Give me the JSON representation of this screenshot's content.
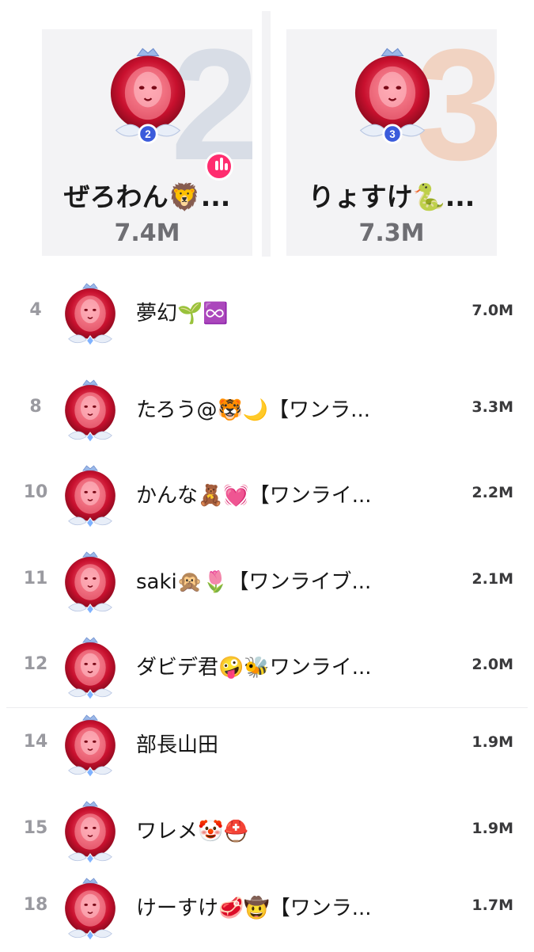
{
  "podium": [
    {
      "place": "2",
      "name": "ぜろわん🦁...",
      "score": "7.4M",
      "ring_color": "#3b5bdb",
      "live": true
    },
    {
      "place": "3",
      "name": "りょすけ🐍...",
      "score": "7.3M",
      "ring_color": "#3b5bdb",
      "live": false
    }
  ],
  "list": [
    {
      "rank": "4",
      "name": "夢幻🌱♾️",
      "score": "7.0M"
    },
    {
      "rank": "8",
      "name": "たろう@🐯🌙【ワンラ...",
      "score": "3.3M"
    },
    {
      "rank": "10",
      "name": "かんな🧸💓【ワンライ...",
      "score": "2.2M"
    },
    {
      "rank": "11",
      "name": "saki🙊🌷【ワンライブ...",
      "score": "2.1M"
    },
    {
      "rank": "12",
      "name": "ダビデ君🤪🐝ワンライ...",
      "score": "2.0M"
    },
    {
      "rank": "14",
      "name": "部長山田",
      "score": "1.9M"
    },
    {
      "rank": "15",
      "name": "ワレメ🤡⛑️",
      "score": "1.9M"
    },
    {
      "rank": "18",
      "name": "けーすけ🥩🤠【ワンラ...",
      "score": "1.7M"
    }
  ],
  "colors": {
    "avatar_red": "#c8102e",
    "badge_live": "#ff2d6f",
    "rank_badge": "#3b5bdb"
  },
  "icons": {
    "avatar": "lion-avatar-icon",
    "frame": "crown-wings-frame-icon",
    "live": "live-equalizer-icon"
  }
}
